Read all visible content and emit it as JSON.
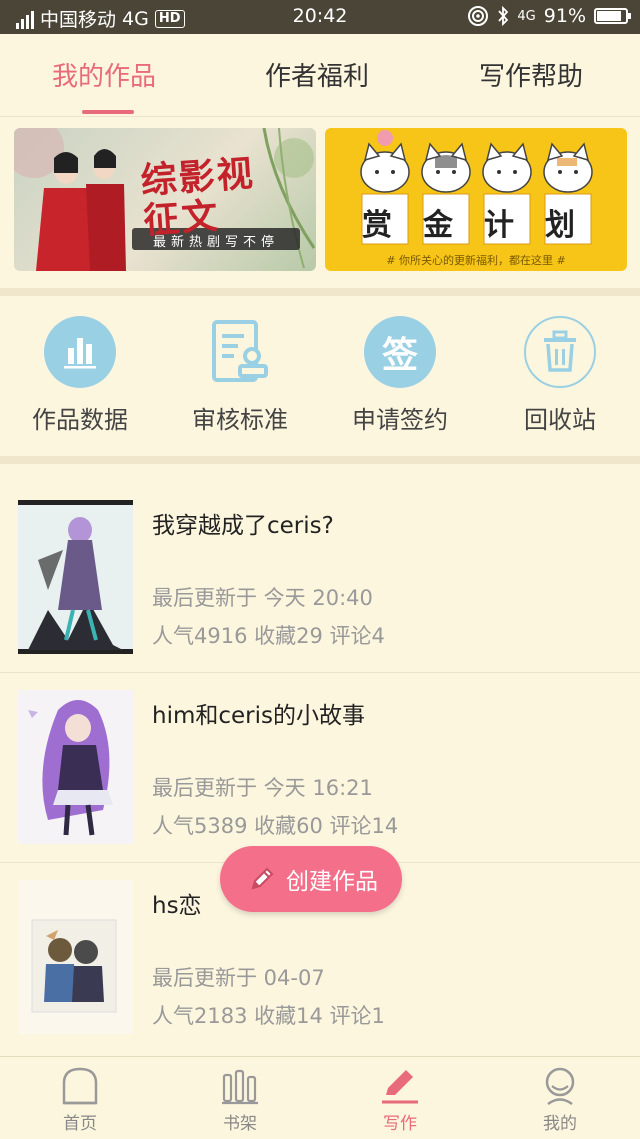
{
  "status_bar": {
    "carrier": "中国移动",
    "network": "4G",
    "hd": "HD",
    "time": "20:42",
    "battery_network": "4G",
    "battery": "91%"
  },
  "tabs": [
    {
      "label": "我的作品",
      "active": true
    },
    {
      "label": "作者福利",
      "active": false
    },
    {
      "label": "写作帮助",
      "active": false
    }
  ],
  "banners": {
    "left": {
      "title": "综影视征文",
      "subtitle": "最新热剧写不停"
    },
    "right": {
      "chars": [
        "赏",
        "金",
        "计",
        "划"
      ],
      "caption": "# 你所关心的更新福利，都在这里 #"
    }
  },
  "actions": [
    {
      "label": "作品数据",
      "icon": "bar-chart-icon"
    },
    {
      "label": "审核标准",
      "icon": "review-document-icon"
    },
    {
      "label": "申请签约",
      "icon": "sign-icon",
      "icon_text": "签"
    },
    {
      "label": "回收站",
      "icon": "trash-icon"
    }
  ],
  "works": [
    {
      "title": "我穿越成了ceris?",
      "updated": "最后更新于 今天 20:40",
      "stats": "人气4916 收藏29 评论4"
    },
    {
      "title": "him和ceris的小故事",
      "updated": "最后更新于 今天 16:21",
      "stats": "人气5389 收藏60 评论14"
    },
    {
      "title": "hs恋",
      "updated": "最后更新于 04-07",
      "stats": "人气2183 收藏14 评论1"
    }
  ],
  "fab": {
    "label": "创建作品"
  },
  "bottom_nav": [
    {
      "label": "首页",
      "active": false
    },
    {
      "label": "书架",
      "active": false
    },
    {
      "label": "写作",
      "active": true
    },
    {
      "label": "我的",
      "active": false
    }
  ],
  "colors": {
    "accent": "#e86b7b",
    "fab": "#f46f8a",
    "icon_blue": "#9ad0e3",
    "background": "#fdf6df"
  }
}
